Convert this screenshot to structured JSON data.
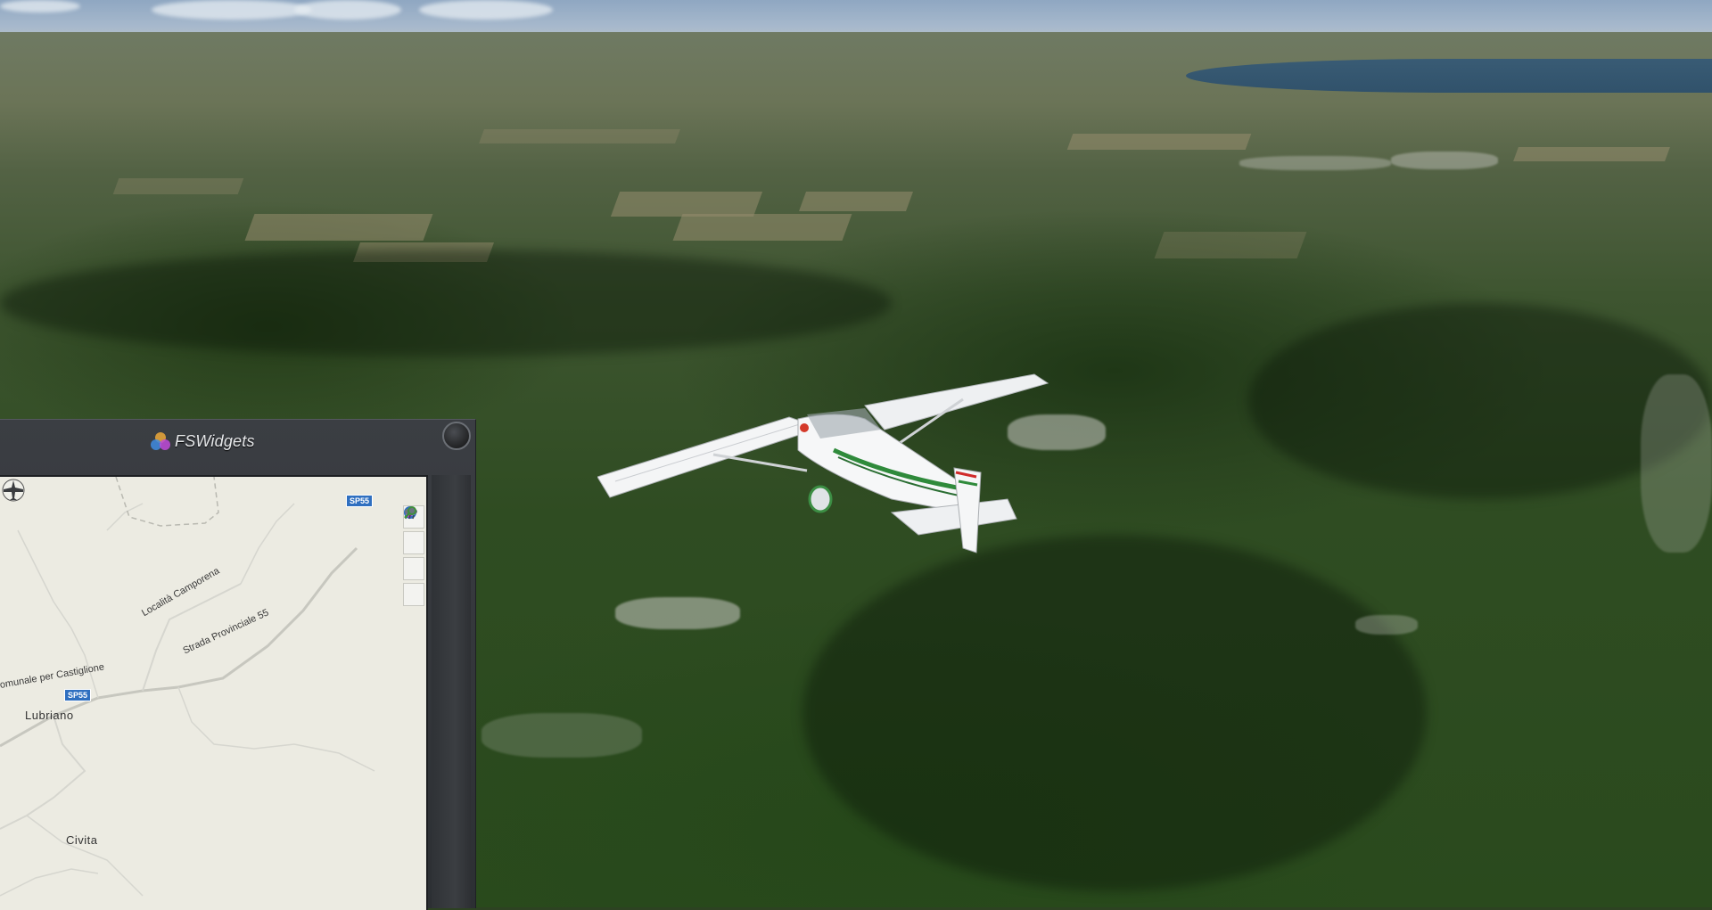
{
  "window": {
    "title": "FSWidgets"
  },
  "widget": {
    "brand_name": "FSWidgets",
    "close_icon": "close-icon",
    "toolbar": [
      {
        "icon": "globe-icon",
        "color": "#2f6fc0"
      },
      {
        "icon": "eraser-icon",
        "color": "#c03ad0"
      },
      {
        "icon": "weather-icon",
        "color": "#5a6470"
      },
      {
        "icon": "search-icon",
        "color": "#3e8f3a"
      }
    ]
  },
  "map": {
    "roads": {
      "top_shield": "SP55",
      "locality_label": "Località Camporena",
      "provincial_label": "Strada Provinciale 55",
      "comunale_label": "omunale per Castiglione",
      "left_shield": "SP55"
    },
    "towns": {
      "town1": "Lubriano",
      "town2": "Civita"
    },
    "aircraft_marker": "aircraft-icon"
  },
  "colors": {
    "map_bg": "#ecebe2",
    "panel_bg": "#33363a",
    "shield_blue": "#2f6fc0"
  }
}
